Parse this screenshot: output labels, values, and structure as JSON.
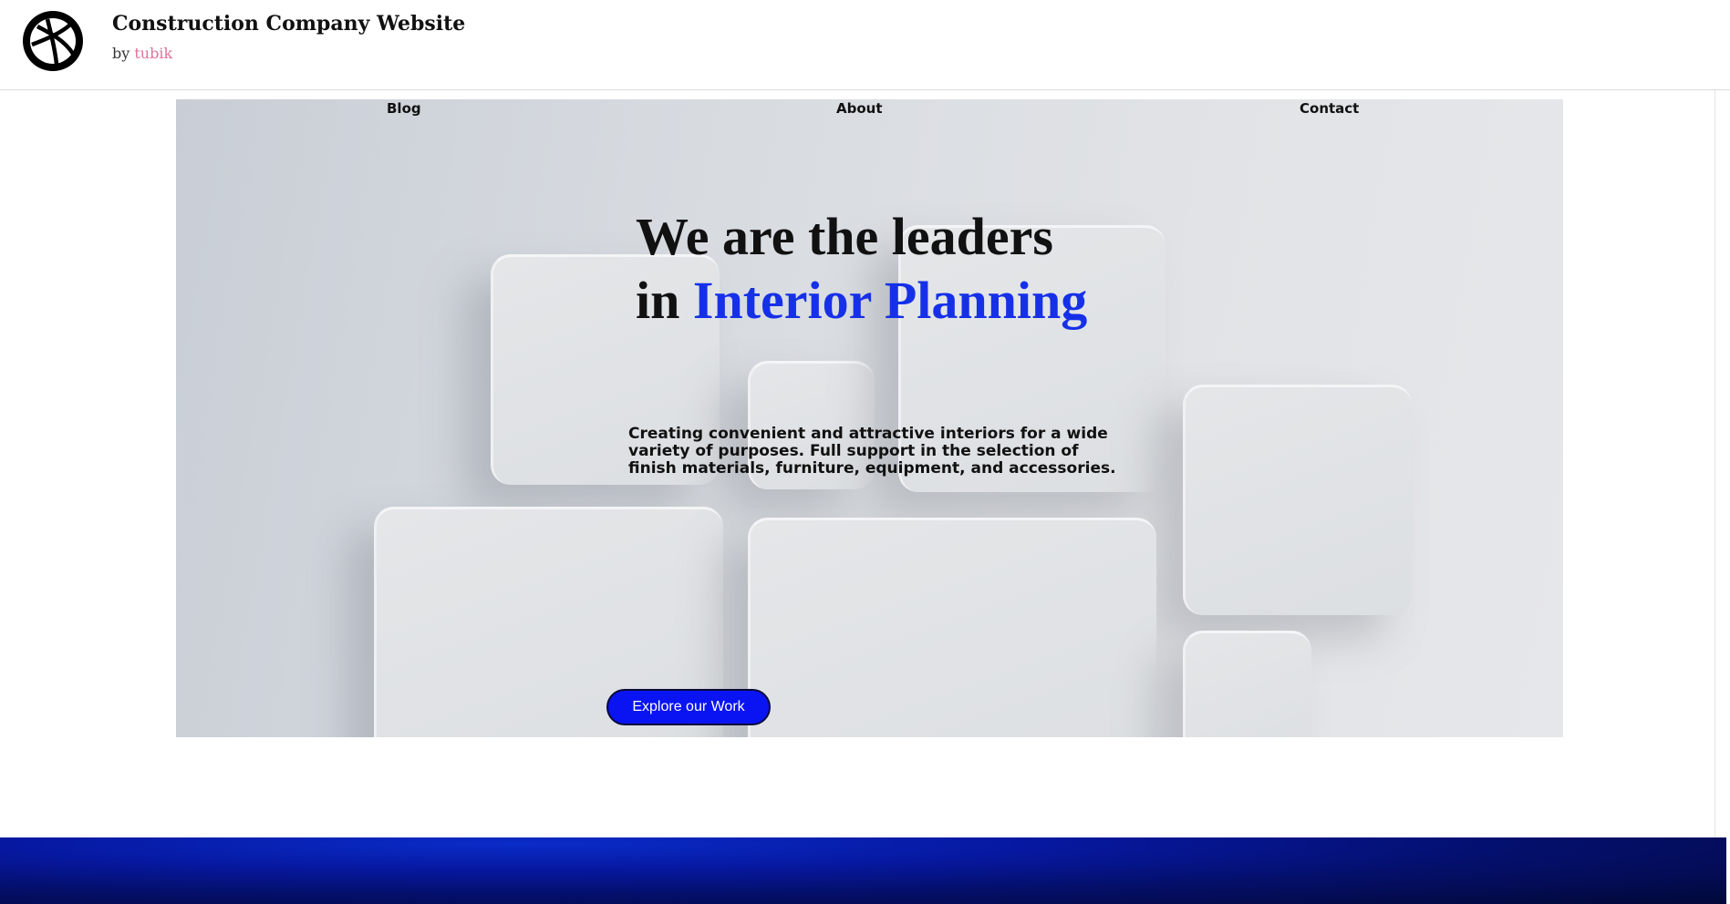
{
  "header": {
    "title": "Construction Company Website",
    "by_prefix": "by",
    "author": "tubik",
    "logo_icon": "dribbble-ball-icon"
  },
  "nav": {
    "items": [
      {
        "label": "Blog"
      },
      {
        "label": "About"
      },
      {
        "label": "Contact"
      }
    ]
  },
  "hero": {
    "headline_line1": "We are the leaders",
    "headline_line2_prefix": "in",
    "headline_line2_accent": "Interior Planning",
    "description": "Creating convenient and attractive interiors for a wide variety of purposes. Full support in the selection of finish materials, furniture, equipment, and accessories.",
    "cta_label": "Explore our Work"
  },
  "colors": {
    "accent": "#1630e8",
    "button": "#0a14f2",
    "author_link": "#e0709a",
    "footer": "#04106a"
  }
}
